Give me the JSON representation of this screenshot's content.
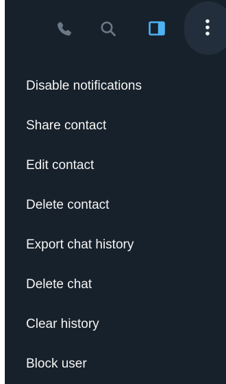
{
  "colors": {
    "panel_background": "#17212b",
    "active_background": "#232e3c",
    "icon_muted": "#6b7886",
    "icon_accent": "#4eb3f5",
    "menu_text": "#f5f5f5"
  },
  "toolbar": {
    "icons": {
      "call": "phone-icon",
      "search": "search-icon",
      "sidebar": "sidebar-panel-icon",
      "more": "three-dot-menu-icon"
    }
  },
  "menu": {
    "items": [
      {
        "label": "Disable notifications"
      },
      {
        "label": "Share contact"
      },
      {
        "label": "Edit contact"
      },
      {
        "label": "Delete contact"
      },
      {
        "label": "Export chat history"
      },
      {
        "label": "Delete chat"
      },
      {
        "label": "Clear history"
      },
      {
        "label": "Block user"
      }
    ]
  }
}
